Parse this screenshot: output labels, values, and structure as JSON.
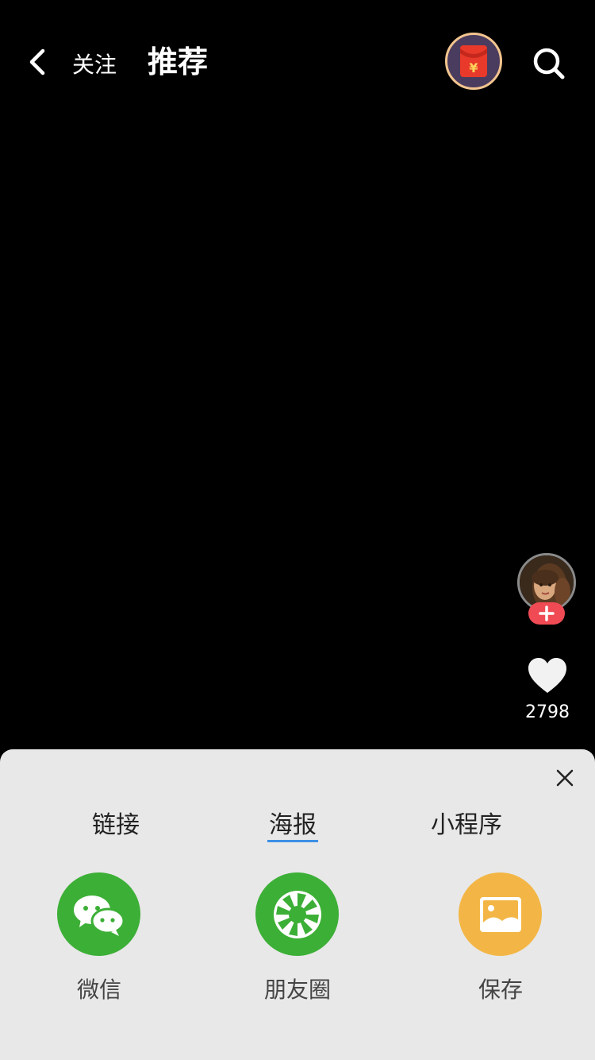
{
  "header": {
    "back_icon": "chevron-left-icon",
    "follow_tab": "关注",
    "recommend_tab": "推荐",
    "redpacket_icon": "red-envelope-icon",
    "redpacket_symbol": "¥",
    "search_icon": "search-icon"
  },
  "right_rail": {
    "avatar_icon": "user-avatar",
    "follow_icon": "plus-icon",
    "like_icon": "heart-icon",
    "like_count": "2798"
  },
  "share_sheet": {
    "close_icon": "close-icon",
    "tabs": [
      {
        "label": "链接",
        "active": false
      },
      {
        "label": "海报",
        "active": true
      },
      {
        "label": "小程序",
        "active": false
      }
    ],
    "targets": [
      {
        "label": "微信",
        "icon": "wechat-icon",
        "color": "#3caf36"
      },
      {
        "label": "朋友圈",
        "icon": "moments-icon",
        "color": "#3caf36"
      },
      {
        "label": "保存",
        "icon": "image-save-icon",
        "color": "#f3b646"
      }
    ]
  },
  "colors": {
    "background": "#000000",
    "sheet_background": "#e8e8e8",
    "accent_underline": "#3d8fe6",
    "follow_plus": "#f04b55",
    "redpacket_border": "#f2c48f"
  }
}
